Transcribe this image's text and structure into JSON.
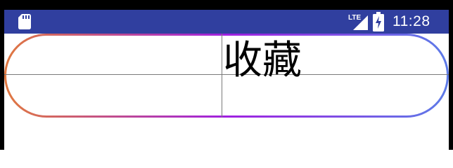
{
  "status_bar": {
    "time": "11:28",
    "network": "LTE",
    "left_icon": "sd-card-icon",
    "background_color": "#303f9f"
  },
  "pill_button": {
    "label": "收藏",
    "gradient_colors": [
      "#e07840",
      "#a020e0",
      "#5d7be8"
    ]
  }
}
